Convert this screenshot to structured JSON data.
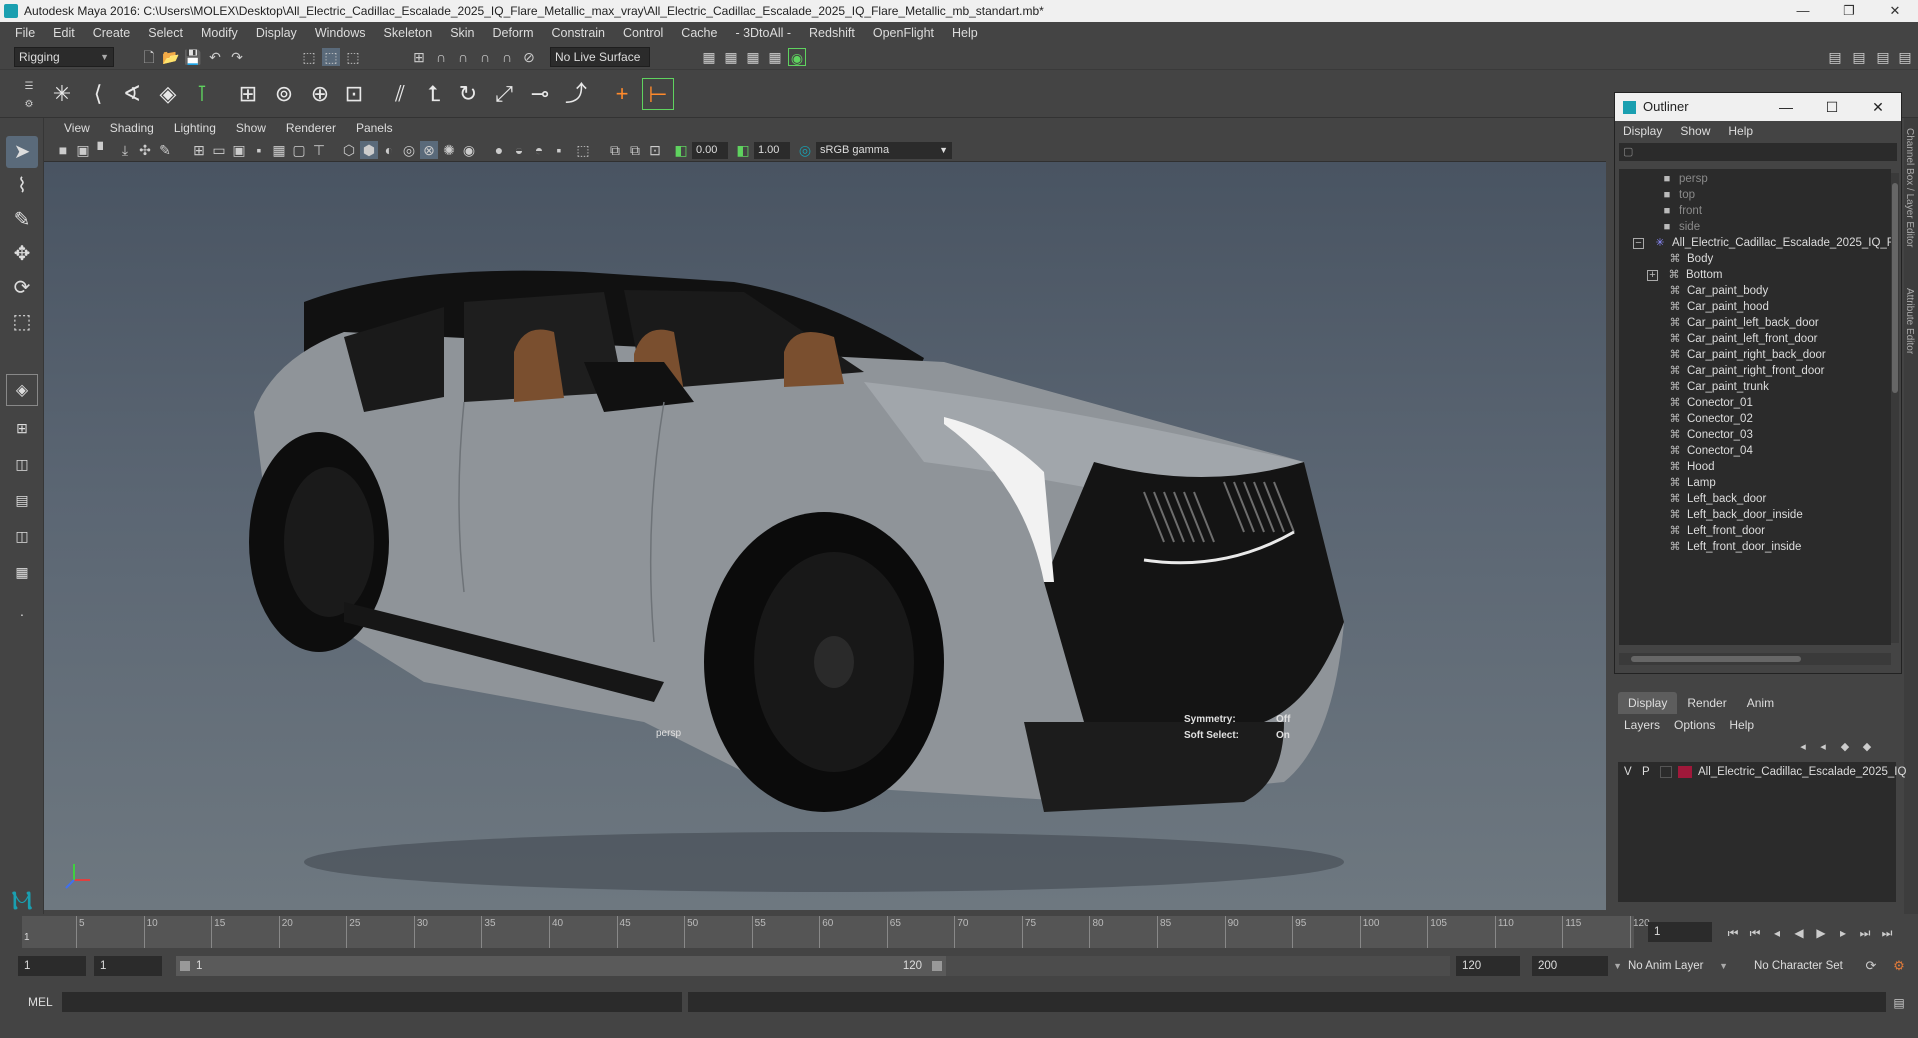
{
  "window": {
    "title": "Autodesk Maya 2016: C:\\Users\\MOLEX\\Desktop\\All_Electric_Cadillac_Escalade_2025_IQ_Flare_Metallic_max_vray\\All_Electric_Cadillac_Escalade_2025_IQ_Flare_Metallic_mb_standart.mb*",
    "min": "—",
    "restore": "❐",
    "close": "✕"
  },
  "menubar": [
    "File",
    "Edit",
    "Create",
    "Select",
    "Modify",
    "Display",
    "Windows",
    "Skeleton",
    "Skin",
    "Deform",
    "Constrain",
    "Control",
    "Cache",
    "- 3DtoAll -",
    "Redshift",
    "OpenFlight",
    "Help"
  ],
  "toolbar": {
    "menuset": "Rigging",
    "live_surface": "No Live Surface"
  },
  "viewport_menu": [
    "View",
    "Shading",
    "Lighting",
    "Show",
    "Renderer",
    "Panels"
  ],
  "viewport_toolbar": {
    "exposure": "0.00",
    "gamma": "1.00",
    "colorspace": "sRGB gamma"
  },
  "viewport": {
    "camera_label": "persp",
    "symmetry_label": "Symmetry:",
    "symmetry_value": "Off",
    "soft_select_label": "Soft Select:",
    "soft_select_value": "On"
  },
  "outliner": {
    "title": "Outliner",
    "menu": [
      "Display",
      "Show",
      "Help"
    ],
    "cameras": [
      "persp",
      "top",
      "front",
      "side"
    ],
    "root": "All_Electric_Cadillac_Escalade_2025_IQ_Fl",
    "children": [
      "Body",
      "Bottom",
      "Car_paint_body",
      "Car_paint_hood",
      "Car_paint_left_back_door",
      "Car_paint_left_front_door",
      "Car_paint_right_back_door",
      "Car_paint_right_front_door",
      "Car_paint_trunk",
      "Conector_01",
      "Conector_02",
      "Conector_03",
      "Conector_04",
      "Hood",
      "Lamp",
      "Left_back_door",
      "Left_back_door_inside",
      "Left_front_door",
      "Left_front_door_inside"
    ]
  },
  "layers": {
    "tabs": [
      "Display",
      "Render",
      "Anim"
    ],
    "menu": [
      "Layers",
      "Options",
      "Help"
    ],
    "layer_v": "V",
    "layer_p": "P",
    "layer_color": "#a0183a",
    "layer_name": "All_Electric_Cadillac_Escalade_2025_IQ"
  },
  "timeline": {
    "ticks": [
      "5",
      "10",
      "15",
      "20",
      "25",
      "30",
      "35",
      "40",
      "45",
      "50",
      "55",
      "60",
      "65",
      "70",
      "75",
      "80",
      "85",
      "90",
      "95",
      "100",
      "105",
      "110",
      "115",
      "120"
    ],
    "start_label": "1",
    "current_frame": "1"
  },
  "range": {
    "start": "1",
    "playback_start": "1",
    "slider_start": "1",
    "slider_end": "120",
    "playback_end": "120",
    "end": "200",
    "anim_layer": "No Anim Layer",
    "character_set": "No Character Set"
  },
  "cmdline": {
    "lang": "MEL"
  },
  "colors": {
    "accent": "#1a9fb0",
    "highlight": "#5fd35f"
  }
}
